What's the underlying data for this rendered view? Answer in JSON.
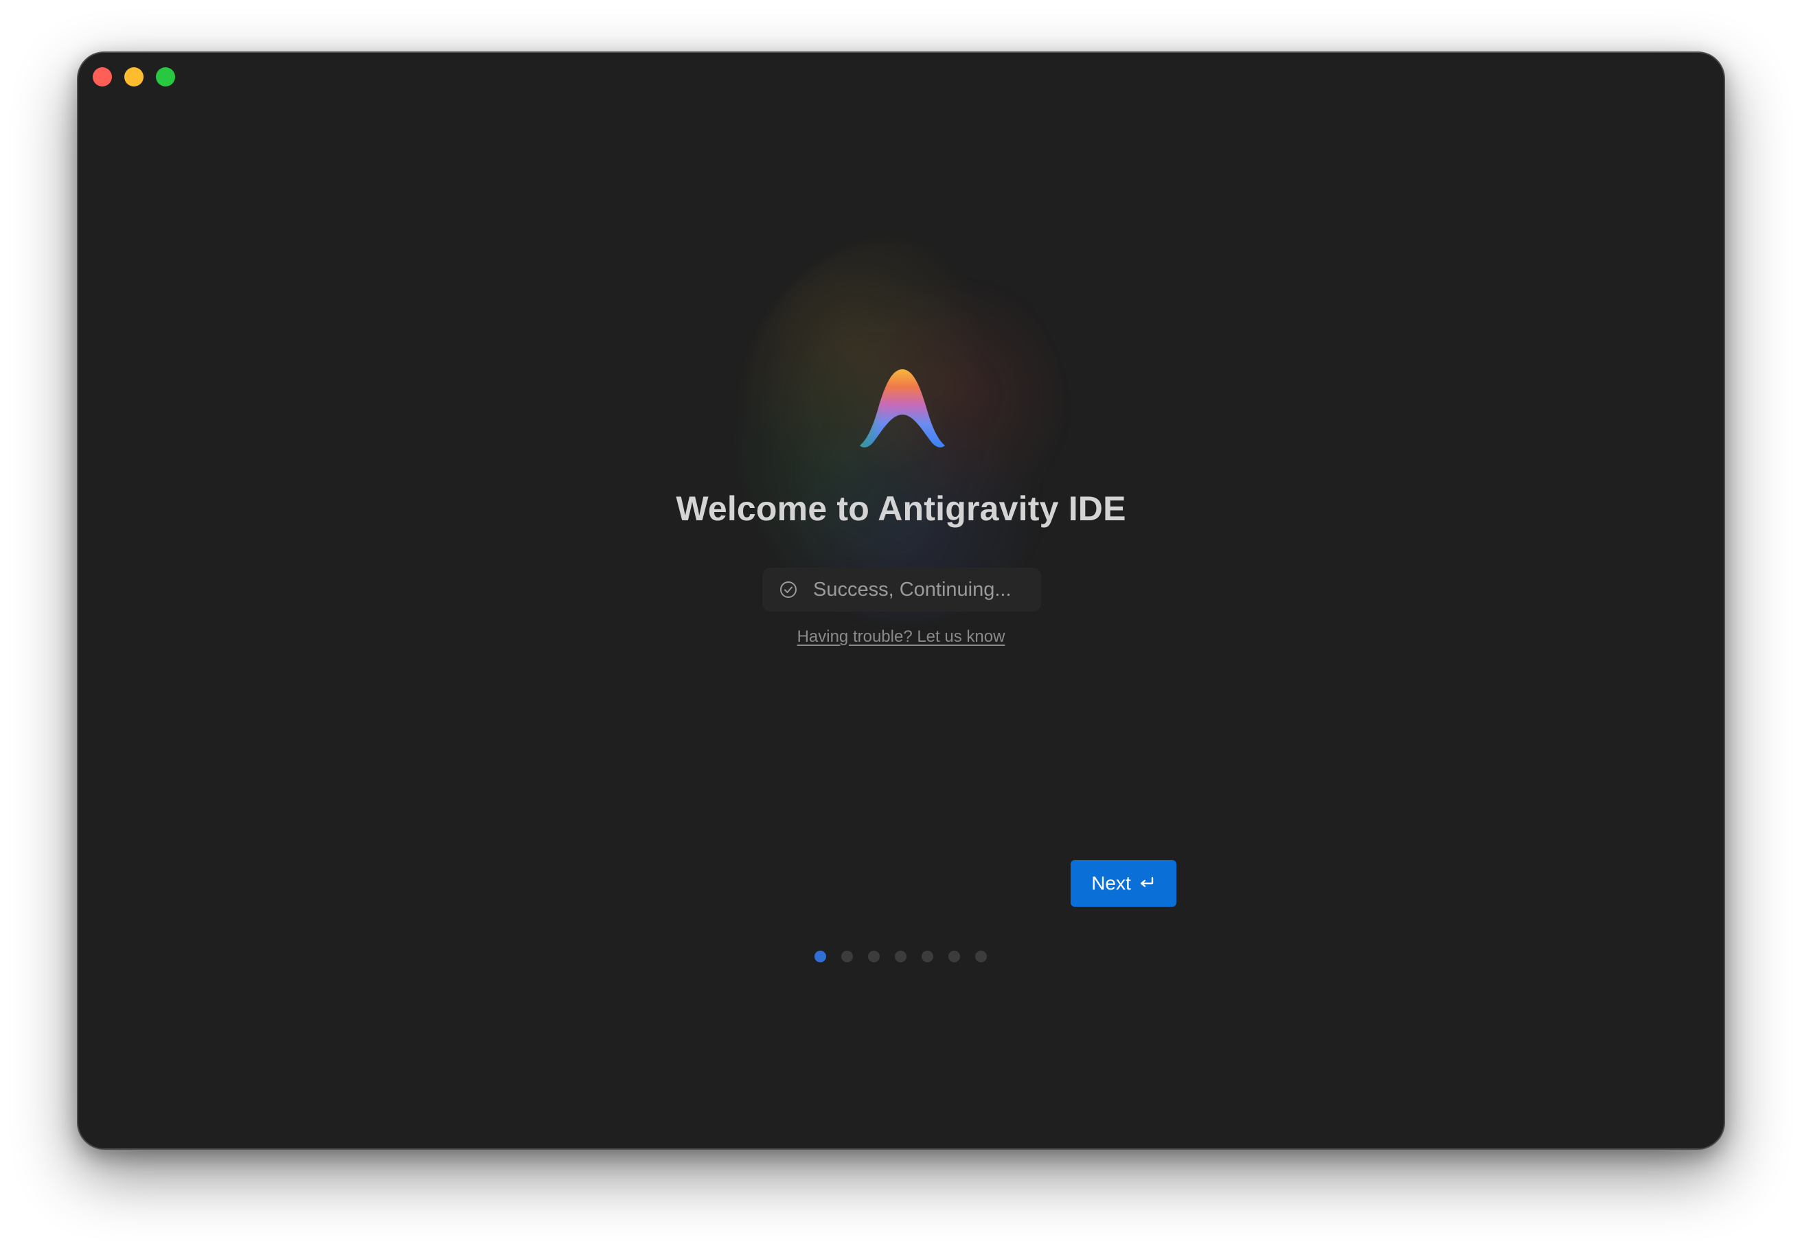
{
  "window": {
    "controls": {
      "close": "close-icon",
      "minimize": "minimize-icon",
      "zoom": "zoom-icon"
    }
  },
  "logo": {
    "icon": "antigravity-logo-icon",
    "gradient": [
      "#f4b400",
      "#ea4335",
      "#34a853",
      "#4285f4"
    ]
  },
  "welcome": {
    "title": "Welcome to Antigravity IDE"
  },
  "status": {
    "icon": "check-circle-icon",
    "text": "Success, Continuing..."
  },
  "help": {
    "link_text": "Having trouble? Let us know"
  },
  "navigation": {
    "next_label": "Next",
    "next_icon": "return-key-icon",
    "accent_color": "#0a6fd6"
  },
  "pagination": {
    "total_steps": 7,
    "current_step": 1
  }
}
